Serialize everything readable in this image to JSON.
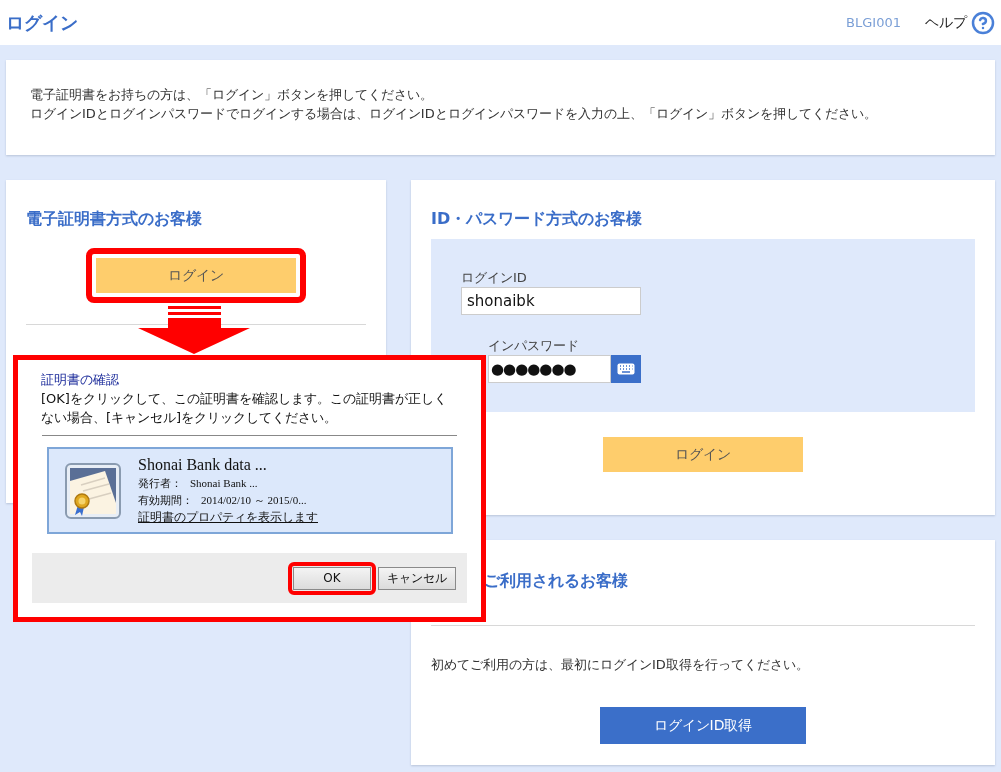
{
  "header": {
    "title": "ログイン",
    "screen_id": "BLGI001",
    "help": "ヘルプ"
  },
  "notice": {
    "lines": [
      "電子証明書をお持ちの方は、「ログイン」ボタンを押してください。",
      "ログインIDとログインパスワードでログインする場合は、ログインIDとログインパスワードを入力の上、「ログイン」ボタンを押してください。"
    ]
  },
  "certificate_login": {
    "title": "電子証明書方式のお客様",
    "button": {
      "label": "ログイン",
      "highlighted": true
    }
  },
  "password_login": {
    "title": "ID・パスワード方式のお客様",
    "fields": [
      {
        "kind": "text",
        "label": "ログインID",
        "value": "shonaibk"
      },
      {
        "kind": "password",
        "label": "インパスワード",
        "value": "●●●●●●●"
      }
    ],
    "button": {
      "label": "ログイン",
      "highlighted": false
    }
  },
  "first_time": {
    "title": "ご利用されるお客様",
    "text": "初めてご利用の方は、最初にログインID取得を行ってください。",
    "button": "ログインID取得"
  },
  "dialog": {
    "title": "証明書の確認",
    "message": "[OK]をクリックして、この証明書を確認します。この証明書が正しくない場合、[キャンセル]をクリックしてください。",
    "certificate": {
      "name": "Shonai Bank data ...",
      "issuer_label": "発行者：",
      "issuer": "Shonai Bank ...",
      "validity_label": "有効期間：",
      "validity": "2014/02/10 ～ 2015/0...",
      "link": "証明書のプロパティを表示します"
    },
    "buttons": [
      {
        "label": "OK",
        "highlighted": true
      },
      {
        "label": "キャンセル",
        "highlighted": false
      }
    ]
  }
}
